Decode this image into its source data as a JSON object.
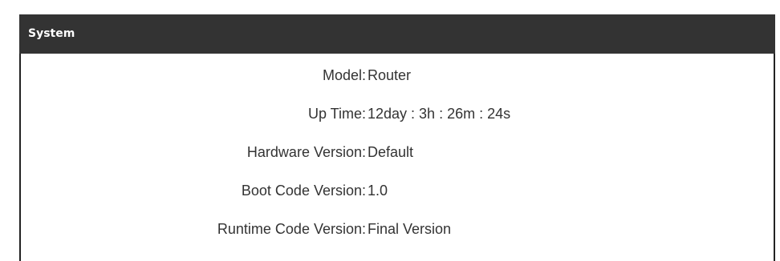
{
  "panel": {
    "title": "System"
  },
  "rows": [
    {
      "label": "Model:",
      "value": "Router"
    },
    {
      "label": "Up Time:",
      "value": "12day : 3h : 26m : 24s"
    },
    {
      "label": "Hardware Version:",
      "value": "Default"
    },
    {
      "label": "Boot Code Version:",
      "value": "1.0"
    },
    {
      "label": "Runtime Code Version:",
      "value": "Final Version"
    }
  ],
  "colors": {
    "header_bg": "#333333",
    "header_text": "#ffffff",
    "text": "#333333",
    "border": "#222222"
  }
}
